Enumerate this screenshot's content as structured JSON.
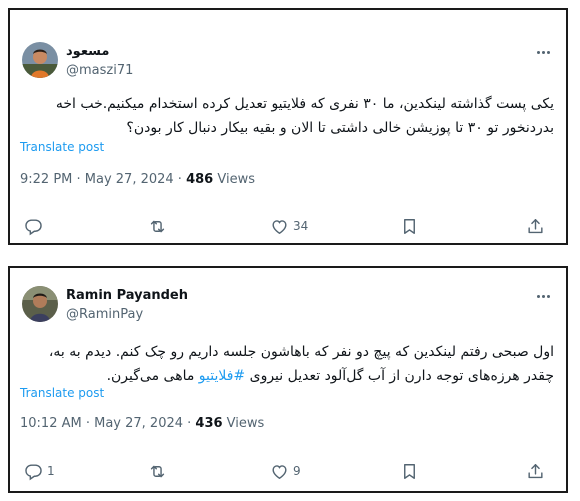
{
  "tweets": [
    {
      "author": {
        "display_name": "مسعود",
        "handle": "@maszi71"
      },
      "text": "یکی پست گذاشته لینکدین، ما ۳۰ نفری که فلایتیو تعدیل کرده استخدام میکنیم.خب اخه بدردنخور تو ۳۰ تا پوزیشن خالی داشتی تا الان و بقیه بیکار دنبال کار بودن؟",
      "translate_label": "Translate post",
      "timestamp": "9:22 PM · May 27, 2024 · ",
      "views_count": "486",
      "views_label": " Views",
      "reply_count": "",
      "like_count": "34"
    },
    {
      "author": {
        "display_name": "Ramin Payandeh",
        "handle": "@RaminPay"
      },
      "text_before": "اول صبحی رفتم لینکدین که پیچ دو نفر که باهاشون جلسه داریم رو چک کنم. دیدم به به، چقدر هرزه‌های توجه دارن از آب گل‌آلود تعدیل نیروی ",
      "hashtag": "#فلایتیو",
      "text_after": " ماهی می‌گیرن.",
      "translate_label": "Translate post",
      "timestamp": "10:12 AM · May 27, 2024 · ",
      "views_count": "436",
      "views_label": " Views",
      "reply_count": "1",
      "like_count": "9"
    }
  ],
  "icons": {
    "reply": "reply-icon",
    "retweet": "retweet-icon",
    "like": "heart-icon",
    "bookmark": "bookmark-icon",
    "share": "share-icon",
    "more": "more-dots-icon"
  },
  "colors": {
    "link": "#1d9bf0",
    "secondary_text": "#536471",
    "primary_text": "#0f1419",
    "card_border": "#1a1a1a"
  }
}
